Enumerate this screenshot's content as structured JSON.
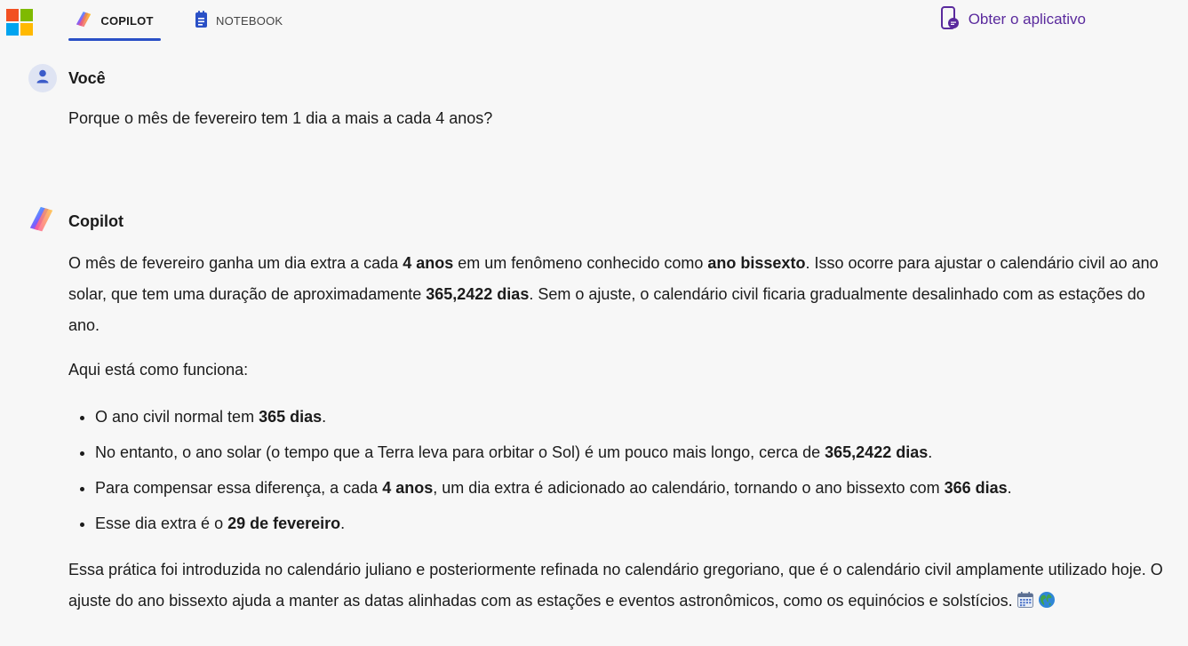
{
  "nav": {
    "tabs": [
      {
        "label": "COPILOT",
        "active": true,
        "icon": "copilot-logo-icon"
      },
      {
        "label": "NOTEBOOK",
        "active": false,
        "icon": "notebook-icon"
      }
    ],
    "get_app_label": "Obter o aplicativo",
    "get_app_icon": "phone-chat-icon"
  },
  "colors": {
    "accent": "#2a50c6",
    "link_purple": "#5a2a9d",
    "background": "#f7f7f7"
  },
  "user_message": {
    "sender": "Você",
    "avatar_icon": "user-icon",
    "text": "Porque o mês de fevereiro tem 1 dia a mais a cada 4 anos?"
  },
  "copilot_message": {
    "sender": "Copilot",
    "avatar_icon": "copilot-logo-icon",
    "intro": {
      "t1": "O mês de fevereiro ganha um dia extra a cada ",
      "b1": "4 anos",
      "t2": " em um fenômeno conhecido como ",
      "b2": "ano bissexto",
      "t3": ". Isso ocorre para ajustar o calendário civil ao ano solar, que tem uma duração de aproximadamente ",
      "b3": "365,2422 dias",
      "t4": ". Sem o ajuste, o calendário civil ficaria gradualmente desalinhado com as estações do ano."
    },
    "how": "Aqui está como funciona:",
    "bullets": [
      {
        "t1": "O ano civil normal tem ",
        "b1": "365 dias",
        "t2": "."
      },
      {
        "t1": "No entanto, o ano solar (o tempo que a Terra leva para orbitar o Sol) é um pouco mais longo, cerca de ",
        "b1": "365,2422 dias",
        "t2": "."
      },
      {
        "t1": "Para compensar essa diferença, a cada ",
        "b1": "4 anos",
        "t2": ", um dia extra é adicionado ao calendário, tornando o ano bissexto com ",
        "b2": "366 dias",
        "t3": "."
      },
      {
        "t1": "Esse dia extra é o ",
        "b1": "29 de fevereiro",
        "t2": "."
      }
    ],
    "closing": "Essa prática foi introduzida no calendário juliano e posteriormente refinada no calendário gregoriano, que é o calendário civil amplamente utilizado hoje. O ajuste do ano bissexto ajuda a manter as datas alinhadas com as estações e eventos astronômicos, como os equinócios e solstícios.",
    "closing_emojis": [
      "calendar-icon",
      "globe-icon"
    ]
  }
}
